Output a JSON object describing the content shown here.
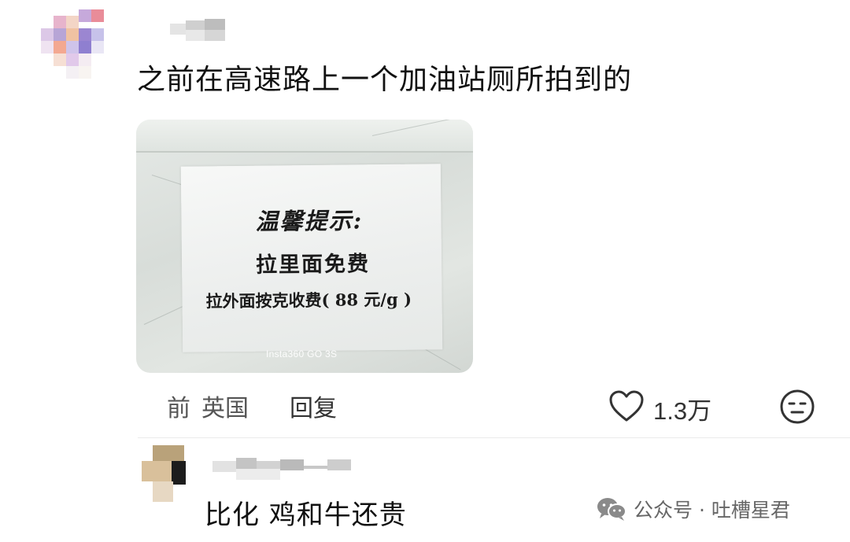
{
  "comment": {
    "text": "之前在高速路上一个加油站厕所拍到的",
    "time_fragment": "前",
    "location": "英国",
    "reply_label": "回复",
    "like_count": "1.3万"
  },
  "photo": {
    "sign_title": "温馨提示:",
    "sign_line1": "拉里面免费",
    "sign_line2": "拉外面按克收费( 88 元/g )",
    "camera_watermark": "Insta360 GO 3S"
  },
  "reply": {
    "text": "比化 鸡和牛还贵"
  },
  "watermark": {
    "text": "公众号 · 吐槽星君",
    "icon": "wechat-icon"
  },
  "icons": {
    "like": "heart-outline-icon",
    "emoji": "neutral-face-icon"
  },
  "colors": {
    "text": "#111111",
    "meta": "#555555",
    "watermark": "#666666"
  }
}
